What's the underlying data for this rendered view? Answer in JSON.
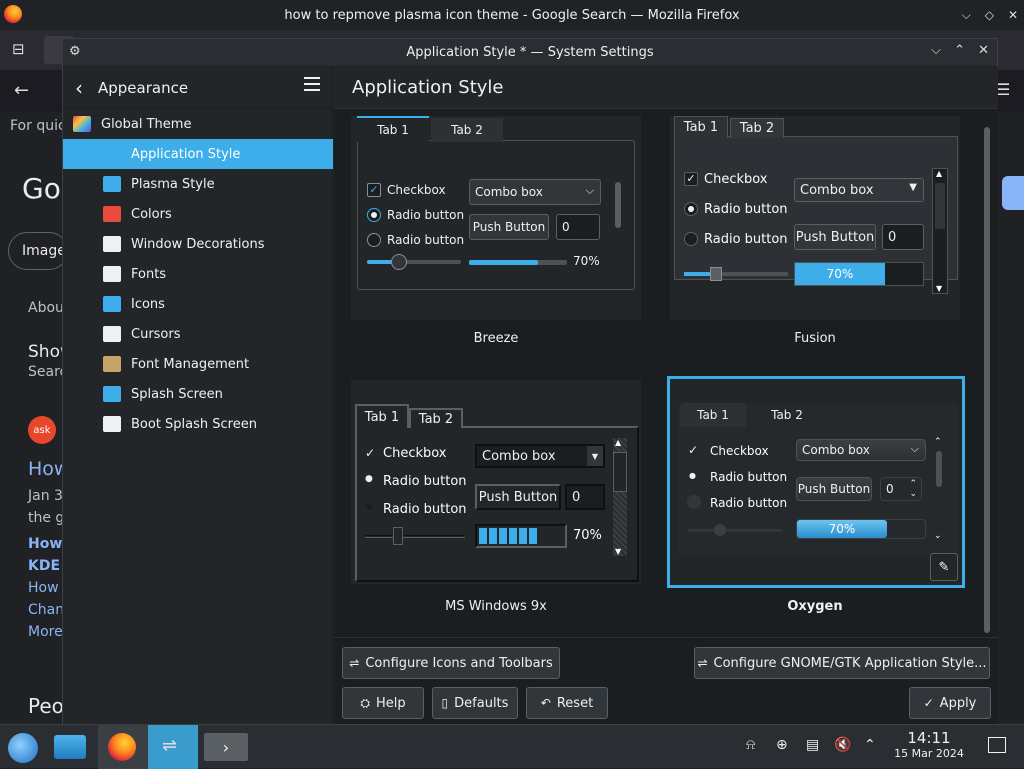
{
  "firefox": {
    "window_title": "how to repmove plasma icon theme - Google Search — Mozilla Firefox",
    "page_fragments": [
      "For quic",
      "Go",
      "Image",
      "Abou",
      "Show",
      "Searc",
      "How",
      "Jan 3",
      "the gr",
      "How",
      "KDE",
      "How c",
      "Chan",
      "More",
      "Peo",
      "ask"
    ]
  },
  "system_settings": {
    "window_title": "Application Style * — System Settings",
    "sidebar": {
      "title": "Appearance",
      "top_item": "Global Theme",
      "items": [
        {
          "label": "Application Style",
          "icon": "application-style-icon",
          "color": "#3daee9",
          "selected": true
        },
        {
          "label": "Plasma Style",
          "icon": "plasma-style-icon",
          "color": "#3daee9",
          "selected": false
        },
        {
          "label": "Colors",
          "icon": "colors-icon",
          "color": "#e94b3c",
          "selected": false
        },
        {
          "label": "Window Decorations",
          "icon": "window-decorations-icon",
          "color": "#eff0f1",
          "selected": false
        },
        {
          "label": "Fonts",
          "icon": "fonts-icon",
          "color": "#eff0f1",
          "selected": false
        },
        {
          "label": "Icons",
          "icon": "icons-icon",
          "color": "#3daee9",
          "selected": false
        },
        {
          "label": "Cursors",
          "icon": "cursors-icon",
          "color": "#eff0f1",
          "selected": false
        },
        {
          "label": "Font Management",
          "icon": "font-management-icon",
          "color": "#c9a46a",
          "selected": false
        },
        {
          "label": "Splash Screen",
          "icon": "splash-screen-icon",
          "color": "#3daee9",
          "selected": false
        },
        {
          "label": "Boot Splash Screen",
          "icon": "boot-splash-icon",
          "color": "#eff0f1",
          "selected": false
        }
      ]
    },
    "page_title": "Application Style",
    "styles": [
      {
        "name": "Breeze",
        "tab1": "Tab 1",
        "tab2": "Tab 2",
        "checkbox": "Checkbox",
        "radio1": "Radio button",
        "radio2": "Radio button",
        "combo": "Combo box",
        "push": "Push Button",
        "spin": "0",
        "progress": "70%",
        "progress_value": 0.7
      },
      {
        "name": "Fusion",
        "tab1": "Tab 1",
        "tab2": "Tab 2",
        "checkbox": "Checkbox",
        "radio1": "Radio button",
        "radio2": "Radio button",
        "combo": "Combo box",
        "push": "Push Button",
        "spin": "0",
        "progress": "70%",
        "progress_value": 0.7
      },
      {
        "name": "MS Windows 9x",
        "tab1": "Tab 1",
        "tab2": "Tab 2",
        "checkbox": "Checkbox",
        "radio1": "Radio button",
        "radio2": "Radio button",
        "combo": "Combo box",
        "push": "Push Button",
        "spin": "0",
        "progress": "70%",
        "progress_value": 0.7
      },
      {
        "name": "Oxygen",
        "tab1": "Tab 1",
        "tab2": "Tab 2",
        "checkbox": "Checkbox",
        "radio1": "Radio button",
        "radio2": "Radio button",
        "combo": "Combo box",
        "push": "Push Button",
        "spin": "0",
        "progress": "70%",
        "progress_value": 0.7
      }
    ],
    "buttons": {
      "configure_icons": "Configure Icons and Toolbars",
      "configure_gtk": "Configure GNOME/GTK Application Style...",
      "help": "Help",
      "defaults": "Defaults",
      "reset": "Reset",
      "apply": "Apply"
    }
  },
  "taskbar": {
    "time": "14:11",
    "date": "15 Mar 2024"
  },
  "colors": {
    "accent": "#3daee9",
    "window_bg": "#232629",
    "content_bg": "#1b1e20"
  }
}
